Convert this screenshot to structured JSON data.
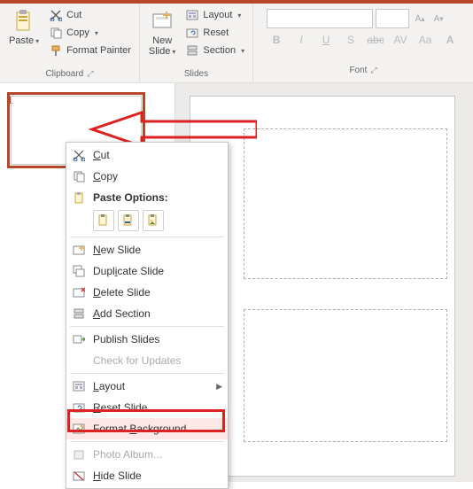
{
  "ribbon": {
    "clipboard": {
      "label": "Clipboard",
      "paste": "Paste",
      "cut": "Cut",
      "copy": "Copy",
      "format_painter": "Format Painter"
    },
    "slides": {
      "label": "Slides",
      "new_slide": "New\nSlide",
      "layout": "Layout",
      "reset": "Reset",
      "section": "Section"
    },
    "font": {
      "label": "Font",
      "b": "B",
      "i": "I",
      "u": "U",
      "s": "S",
      "abc": "abc",
      "av": "AV",
      "aa": "Aa",
      "a_bold": "A"
    }
  },
  "sidebar": {
    "slide_number": "1"
  },
  "context": {
    "cut": "Cut",
    "copy": "Copy",
    "paste_label": "Paste Options:",
    "new_slide": "New Slide",
    "duplicate": "Duplicate Slide",
    "delete": "Delete Slide",
    "add_section": "Add Section",
    "publish": "Publish Slides",
    "check_updates": "Check for Updates",
    "layout": "Layout",
    "reset": "Reset Slide",
    "format_bg": "Format Background...",
    "photo_album": "Photo Album...",
    "hide_slide": "Hide Slide"
  }
}
